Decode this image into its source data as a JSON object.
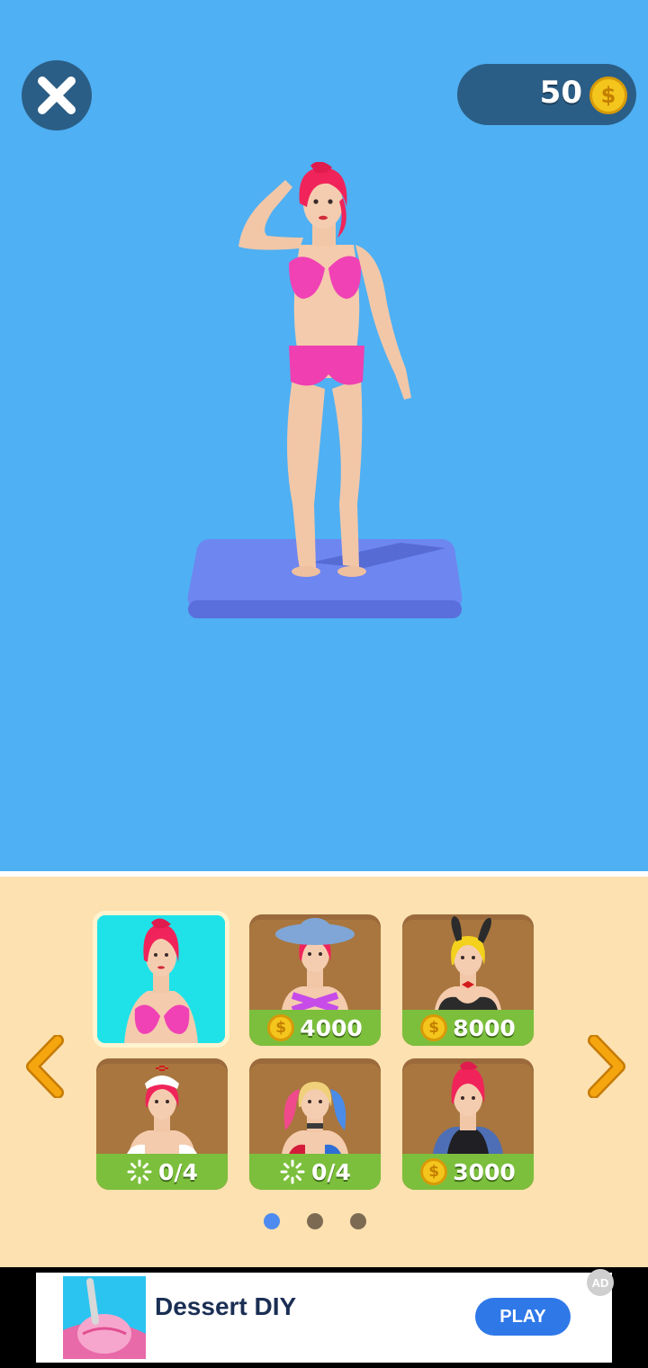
{
  "hud": {
    "coins": "50",
    "close_icon": "close-icon",
    "coin_icon": "coin-icon"
  },
  "shop": {
    "skins": [
      {
        "id": "skin-pink-bikini",
        "selected": true,
        "price": "",
        "status": ""
      },
      {
        "id": "skin-hat-bikini",
        "selected": false,
        "price": "4000",
        "status": ""
      },
      {
        "id": "skin-bunny",
        "selected": false,
        "price": "8000",
        "status": ""
      },
      {
        "id": "skin-nurse",
        "selected": false,
        "price": "",
        "status": "0/4"
      },
      {
        "id": "skin-pigtails",
        "selected": false,
        "price": "",
        "status": "0/4"
      },
      {
        "id": "skin-vest",
        "selected": false,
        "price": "3000",
        "status": ""
      }
    ],
    "pages": 3,
    "current_page": 1
  },
  "ad": {
    "title": "Dessert DIY",
    "button": "PLAY",
    "badge": "AD"
  },
  "colors": {
    "sky": "#4fb0f3",
    "hud_pill": "#2b5e86",
    "shop_bg": "#fde1b0",
    "price_bar": "#7cbf3c",
    "selected_card": "#1fe2e8",
    "arrow": "#f0a20d",
    "dot_active": "#4d8bf0",
    "dot_inactive": "#7c6a52"
  }
}
